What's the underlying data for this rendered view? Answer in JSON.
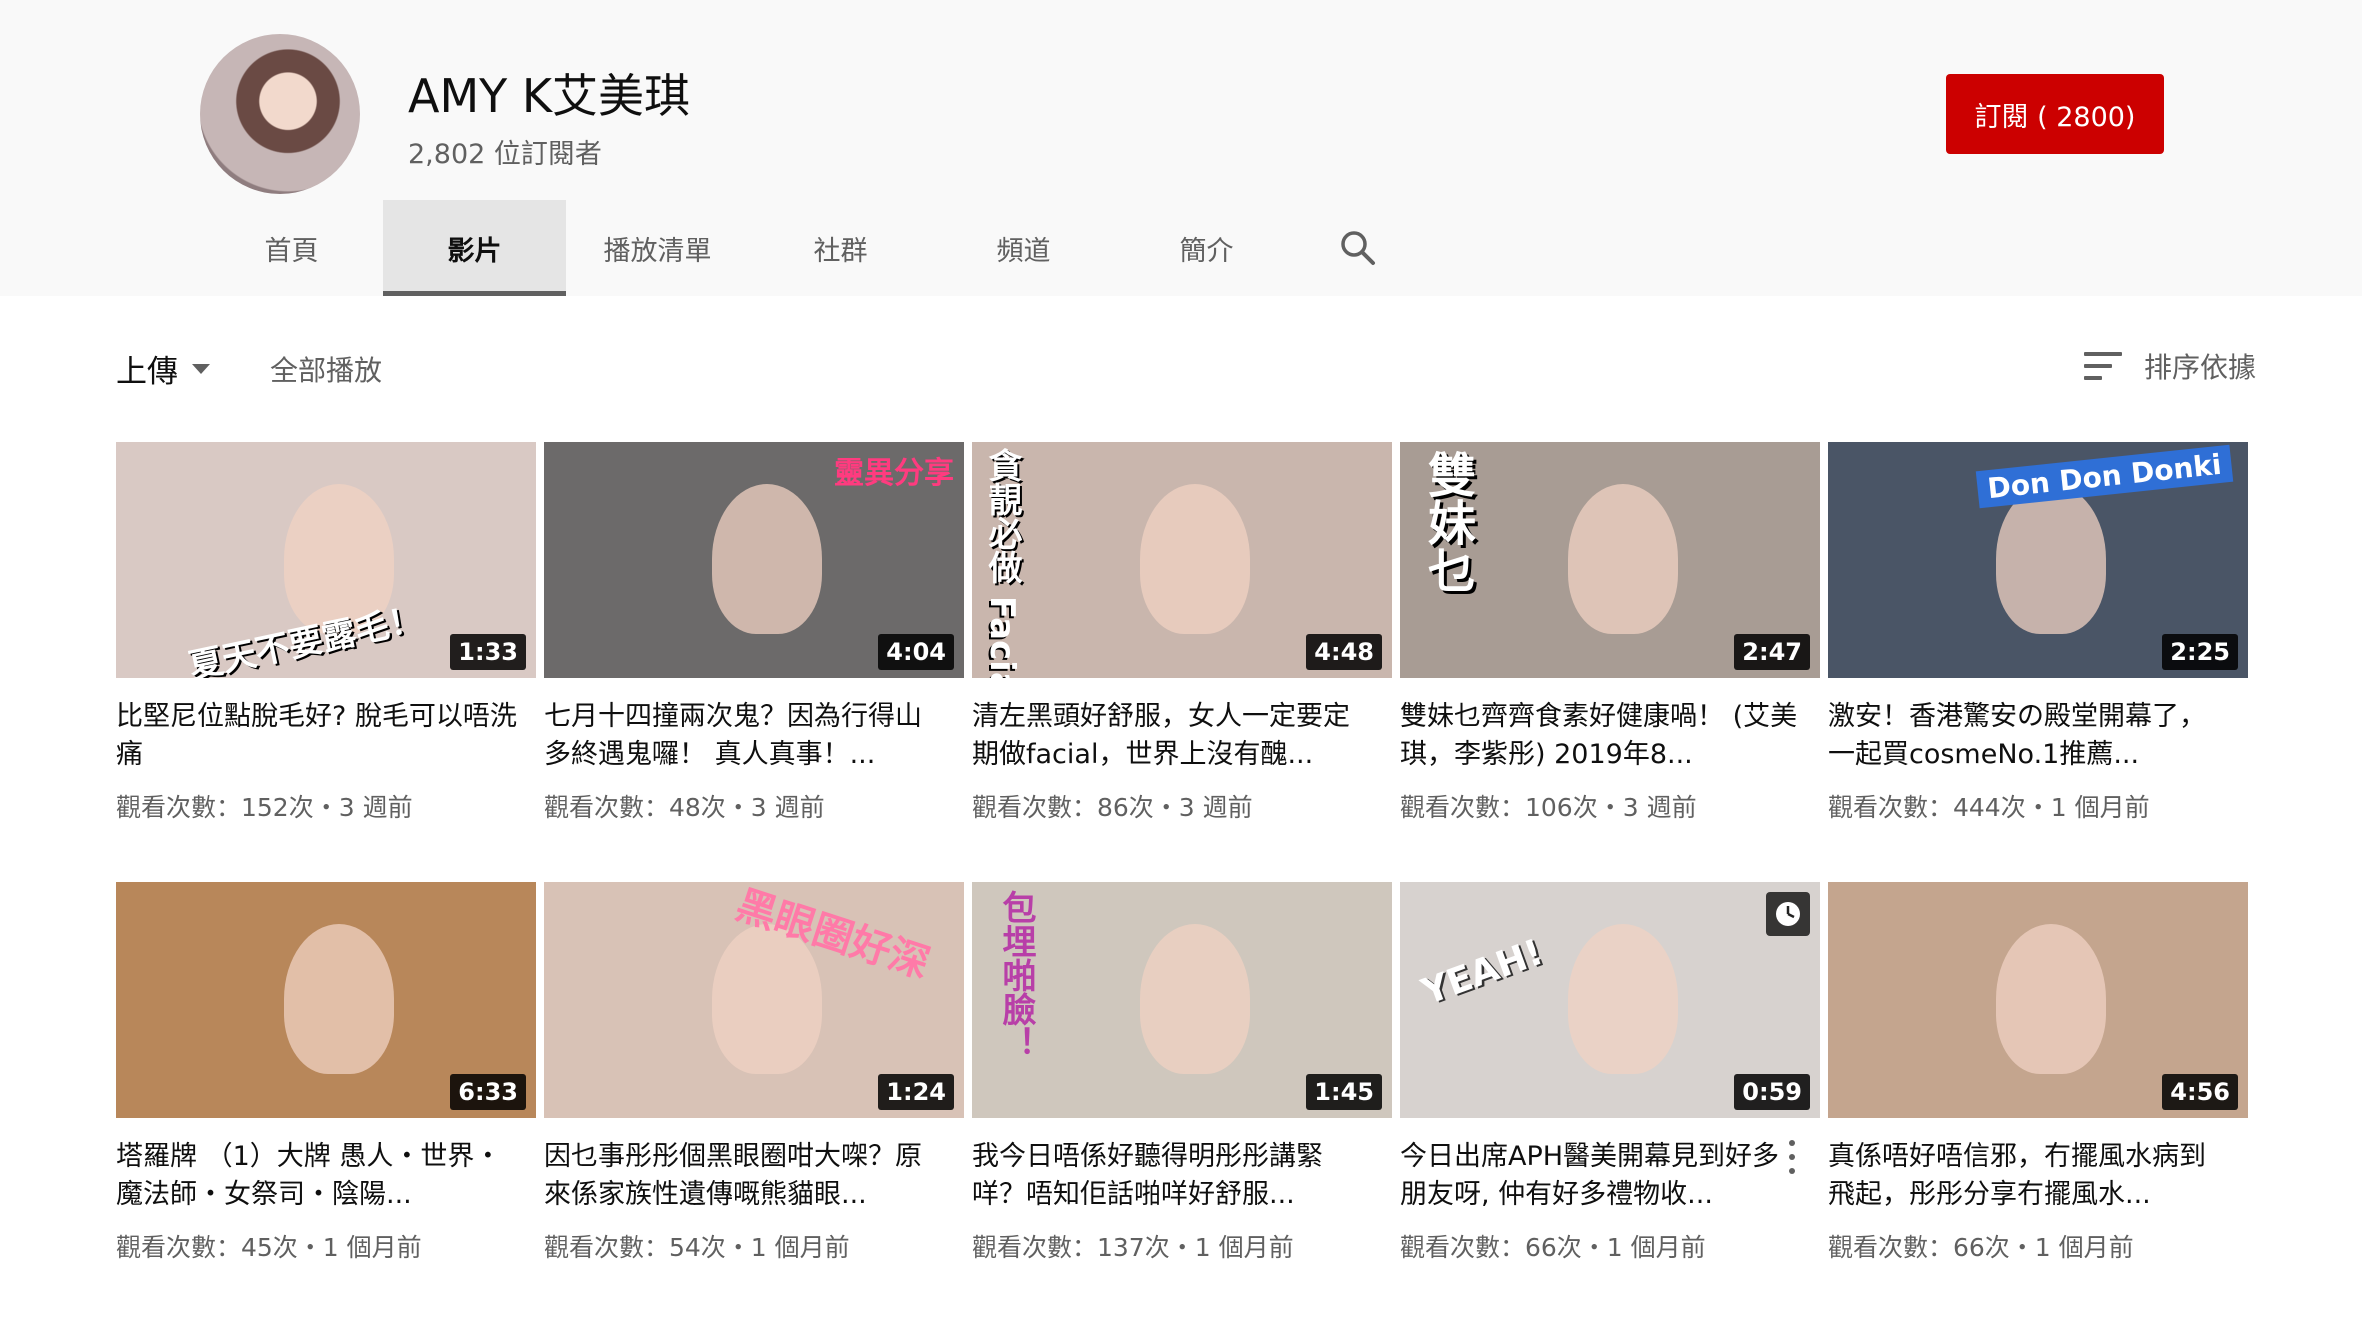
{
  "channel": {
    "name": "AMY K艾美琪",
    "subscribers": "2,802 位訂閱者",
    "subscribe_label": "訂閱 ( 2800)"
  },
  "tabs": [
    {
      "label": "首頁",
      "active": false
    },
    {
      "label": "影片",
      "active": true
    },
    {
      "label": "播放清單",
      "active": false
    },
    {
      "label": "社群",
      "active": false
    },
    {
      "label": "頻道",
      "active": false
    },
    {
      "label": "簡介",
      "active": false
    }
  ],
  "toolbar": {
    "uploads_label": "上傳",
    "play_all_label": "全部播放",
    "sort_label": "排序依據"
  },
  "videos": [
    {
      "title": "比堅尼位點脫毛好? 脫毛可以唔洗痛",
      "meta": "觀看次數：152次・3 週前",
      "duration": "1:33",
      "thumb_text": "夏天不要露毛！",
      "thumb_bg": "#d9c9c4"
    },
    {
      "title": "七月十四撞兩次鬼？因為行得山多終遇鬼囉！ 真人真事！...",
      "meta": "觀看次數：48次・3 週前",
      "duration": "4:04",
      "thumb_text": "靈異分享",
      "thumb_bg": "#6c6a6a"
    },
    {
      "title": "清左黑頭好舒服，女人一定要定期做facial，世界上沒有醜...",
      "meta": "觀看次數：86次・3 週前",
      "duration": "4:48",
      "thumb_text": "貪靚必做 Facial",
      "thumb_bg": "#c9b6ad"
    },
    {
      "title": "雙妹乜齊齊食素好健康喎！ (艾美琪，李紫彤) 2019年8...",
      "meta": "觀看次數：106次・3 週前",
      "duration": "2:47",
      "thumb_text": "雙妹乜",
      "thumb_bg": "#a89c94"
    },
    {
      "title": "激安！香港驚安の殿堂開幕了，一起買cosmeNo.1推薦...",
      "meta": "觀看次數：444次・1 個月前",
      "duration": "2:25",
      "thumb_text": "Don Don Donki",
      "thumb_bg": "#4a5566"
    },
    {
      "title": "塔羅牌 （1）大牌 愚人・世界・魔法師・女祭司・陰陽...",
      "meta": "觀看次數：45次・1 個月前",
      "duration": "6:33",
      "thumb_text": "",
      "thumb_bg": "#b8875a"
    },
    {
      "title": "因乜事彤彤個黑眼圈咁大㗎？原來係家族性遺傳嘅熊貓眼...",
      "meta": "觀看次數：54次・1 個月前",
      "duration": "1:24",
      "thumb_text": "黑眼圈好深",
      "thumb_bg": "#d8c2b6"
    },
    {
      "title": "我今日唔係好聽得明彤彤講緊咩？唔知佢話啪咩好舒服...",
      "meta": "觀看次數：137次・1 個月前",
      "duration": "1:45",
      "thumb_text": "包埋啪臉！",
      "thumb_bg": "#cfc7bd"
    },
    {
      "title": "今日出席APH醫美開幕見到好多朋友呀, 仲有好多禮物收...",
      "meta": "觀看次數：66次・1 個月前",
      "duration": "0:59",
      "thumb_text": "YEAH!",
      "thumb_bg": "#d7d2cf"
    },
    {
      "title": "真係唔好唔信邪，冇擺風水病到飛起，彤彤分享冇擺風水...",
      "meta": "觀看次數：66次・1 個月前",
      "duration": "4:56",
      "thumb_text": "",
      "thumb_bg": "#c4a58e"
    }
  ]
}
